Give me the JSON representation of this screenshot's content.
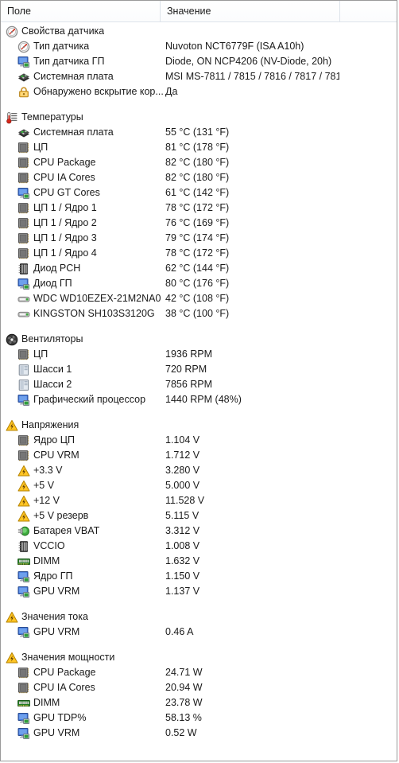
{
  "header": {
    "columns": [
      "Поле",
      "Значение",
      ""
    ]
  },
  "colors": {
    "border": "#9a9a9a",
    "header_line": "#dde3ea",
    "text": "#1a1a1a",
    "warning": "#ffc423",
    "chip_gold": "#c8a23c",
    "led_green": "#3fa63f"
  },
  "sections": [
    {
      "title": "Свойства датчика",
      "icon": "gauge-icon",
      "rows": [
        {
          "icon": "gauge-icon",
          "label": "Тип датчика",
          "value": "Nuvoton NCT6779F  (ISA A10h)"
        },
        {
          "icon": "monitor-icon",
          "label": "Тип датчика ГП",
          "value": "Diode, ON NCP4206  (NV-Diode, 20h)"
        },
        {
          "icon": "mainboard-icon",
          "label": "Системная плата",
          "value": "MSI MS-7811 / 7815 / 7816 / 7817 / 781..."
        },
        {
          "icon": "lock-icon",
          "label": "Обнаружено вскрытие кор...",
          "value": "Да"
        }
      ]
    },
    {
      "title": "Температуры",
      "icon": "thermometer-icon",
      "rows": [
        {
          "icon": "mainboard-icon",
          "label": "Системная плата",
          "value": "55 °C  (131 °F)"
        },
        {
          "icon": "cpu-icon",
          "label": "ЦП",
          "value": "81 °C  (178 °F)"
        },
        {
          "icon": "cpu-icon",
          "label": "CPU Package",
          "value": "82 °C  (180 °F)"
        },
        {
          "icon": "cpu-icon",
          "label": "CPU IA Cores",
          "value": "82 °C  (180 °F)"
        },
        {
          "icon": "monitor-icon",
          "label": "CPU GT Cores",
          "value": "61 °C  (142 °F)"
        },
        {
          "icon": "cpu-icon",
          "label": "ЦП 1 / Ядро 1",
          "value": "78 °C  (172 °F)"
        },
        {
          "icon": "cpu-icon",
          "label": "ЦП 1 / Ядро 2",
          "value": "76 °C  (169 °F)"
        },
        {
          "icon": "cpu-icon",
          "label": "ЦП 1 / Ядро 3",
          "value": "79 °C  (174 °F)"
        },
        {
          "icon": "cpu-icon",
          "label": "ЦП 1 / Ядро 4",
          "value": "78 °C  (172 °F)"
        },
        {
          "icon": "chip-icon",
          "label": "Диод PCH",
          "value": "62 °C  (144 °F)"
        },
        {
          "icon": "monitor-icon",
          "label": "Диод ГП",
          "value": "80 °C  (176 °F)"
        },
        {
          "icon": "hdd-icon",
          "label": "WDC WD10EZEX-21M2NA0",
          "value": "42 °C  (108 °F)"
        },
        {
          "icon": "hdd-icon",
          "label": "KINGSTON SH103S3120G",
          "value": "38 °C  (100 °F)"
        }
      ]
    },
    {
      "title": "Вентиляторы",
      "icon": "fan-icon",
      "rows": [
        {
          "icon": "cpu-icon",
          "label": "ЦП",
          "value": "1936 RPM"
        },
        {
          "icon": "chassis-icon",
          "label": "Шасси 1",
          "value": "720 RPM"
        },
        {
          "icon": "chassis-icon",
          "label": "Шасси 2",
          "value": "7856 RPM"
        },
        {
          "icon": "monitor-icon",
          "label": "Графический процессор",
          "value": "1440 RPM  (48%)"
        }
      ]
    },
    {
      "title": "Напряжения",
      "icon": "warning-icon",
      "rows": [
        {
          "icon": "cpu-icon",
          "label": "Ядро ЦП",
          "value": "1.104 V"
        },
        {
          "icon": "cpu-icon",
          "label": "CPU VRM",
          "value": "1.712 V"
        },
        {
          "icon": "warning-icon",
          "label": "+3.3 V",
          "value": "3.280 V"
        },
        {
          "icon": "warning-icon",
          "label": "+5 V",
          "value": "5.000 V"
        },
        {
          "icon": "warning-icon",
          "label": "+12 V",
          "value": "11.528 V"
        },
        {
          "icon": "warning-icon",
          "label": "+5 V резерв",
          "value": "5.115 V"
        },
        {
          "icon": "battery-icon",
          "label": "Батарея VBAT",
          "value": "3.312 V"
        },
        {
          "icon": "chip-icon",
          "label": "VCCIO",
          "value": "1.008 V"
        },
        {
          "icon": "dimm-icon",
          "label": "DIMM",
          "value": "1.632 V"
        },
        {
          "icon": "monitor-icon",
          "label": "Ядро ГП",
          "value": "1.150 V"
        },
        {
          "icon": "monitor-icon",
          "label": "GPU VRM",
          "value": "1.137 V"
        }
      ]
    },
    {
      "title": "Значения тока",
      "icon": "warning-icon",
      "rows": [
        {
          "icon": "monitor-icon",
          "label": "GPU VRM",
          "value": "0.46 A"
        }
      ]
    },
    {
      "title": "Значения мощности",
      "icon": "warning-icon",
      "rows": [
        {
          "icon": "cpu-icon",
          "label": "CPU Package",
          "value": "24.71 W"
        },
        {
          "icon": "cpu-icon",
          "label": "CPU IA Cores",
          "value": "20.94 W"
        },
        {
          "icon": "dimm-icon",
          "label": "DIMM",
          "value": "23.78 W"
        },
        {
          "icon": "monitor-icon",
          "label": "GPU TDP%",
          "value": "58.13 %"
        },
        {
          "icon": "monitor-icon",
          "label": "GPU VRM",
          "value": "0.52 W"
        }
      ]
    }
  ]
}
